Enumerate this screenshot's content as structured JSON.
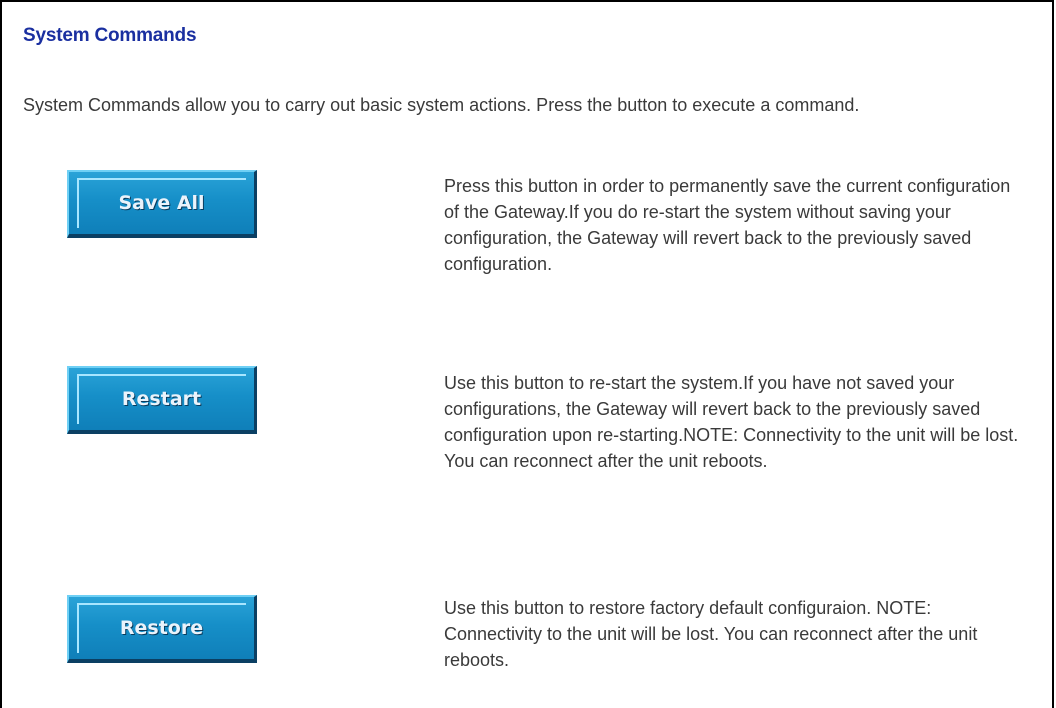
{
  "page": {
    "title": "System Commands",
    "intro": "System Commands allow you to carry out basic system actions. Press the button to execute a command."
  },
  "commands": [
    {
      "label": "Save All",
      "description": "Press this button in order to permanently save the current configuration of the Gateway.If you do re-start the system without saving your configuration, the Gateway will revert back to the previously saved configuration."
    },
    {
      "label": "Restart",
      "description": "Use this button to re-start the system.If you have not saved your configurations, the Gateway will revert back to the previously saved configuration upon re-starting.NOTE: Connectivity to the unit will be lost. You can reconnect after the unit reboots."
    },
    {
      "label": "Restore",
      "description": "Use this button to restore factory default configuraion. NOTE: Connectivity to the unit will be lost. You can reconnect after the unit reboots."
    }
  ],
  "colors": {
    "title": "#1a2fa0",
    "button_face": "#168fc8",
    "button_shadow": "#0b3f63",
    "body_text": "#3a3a3a"
  }
}
